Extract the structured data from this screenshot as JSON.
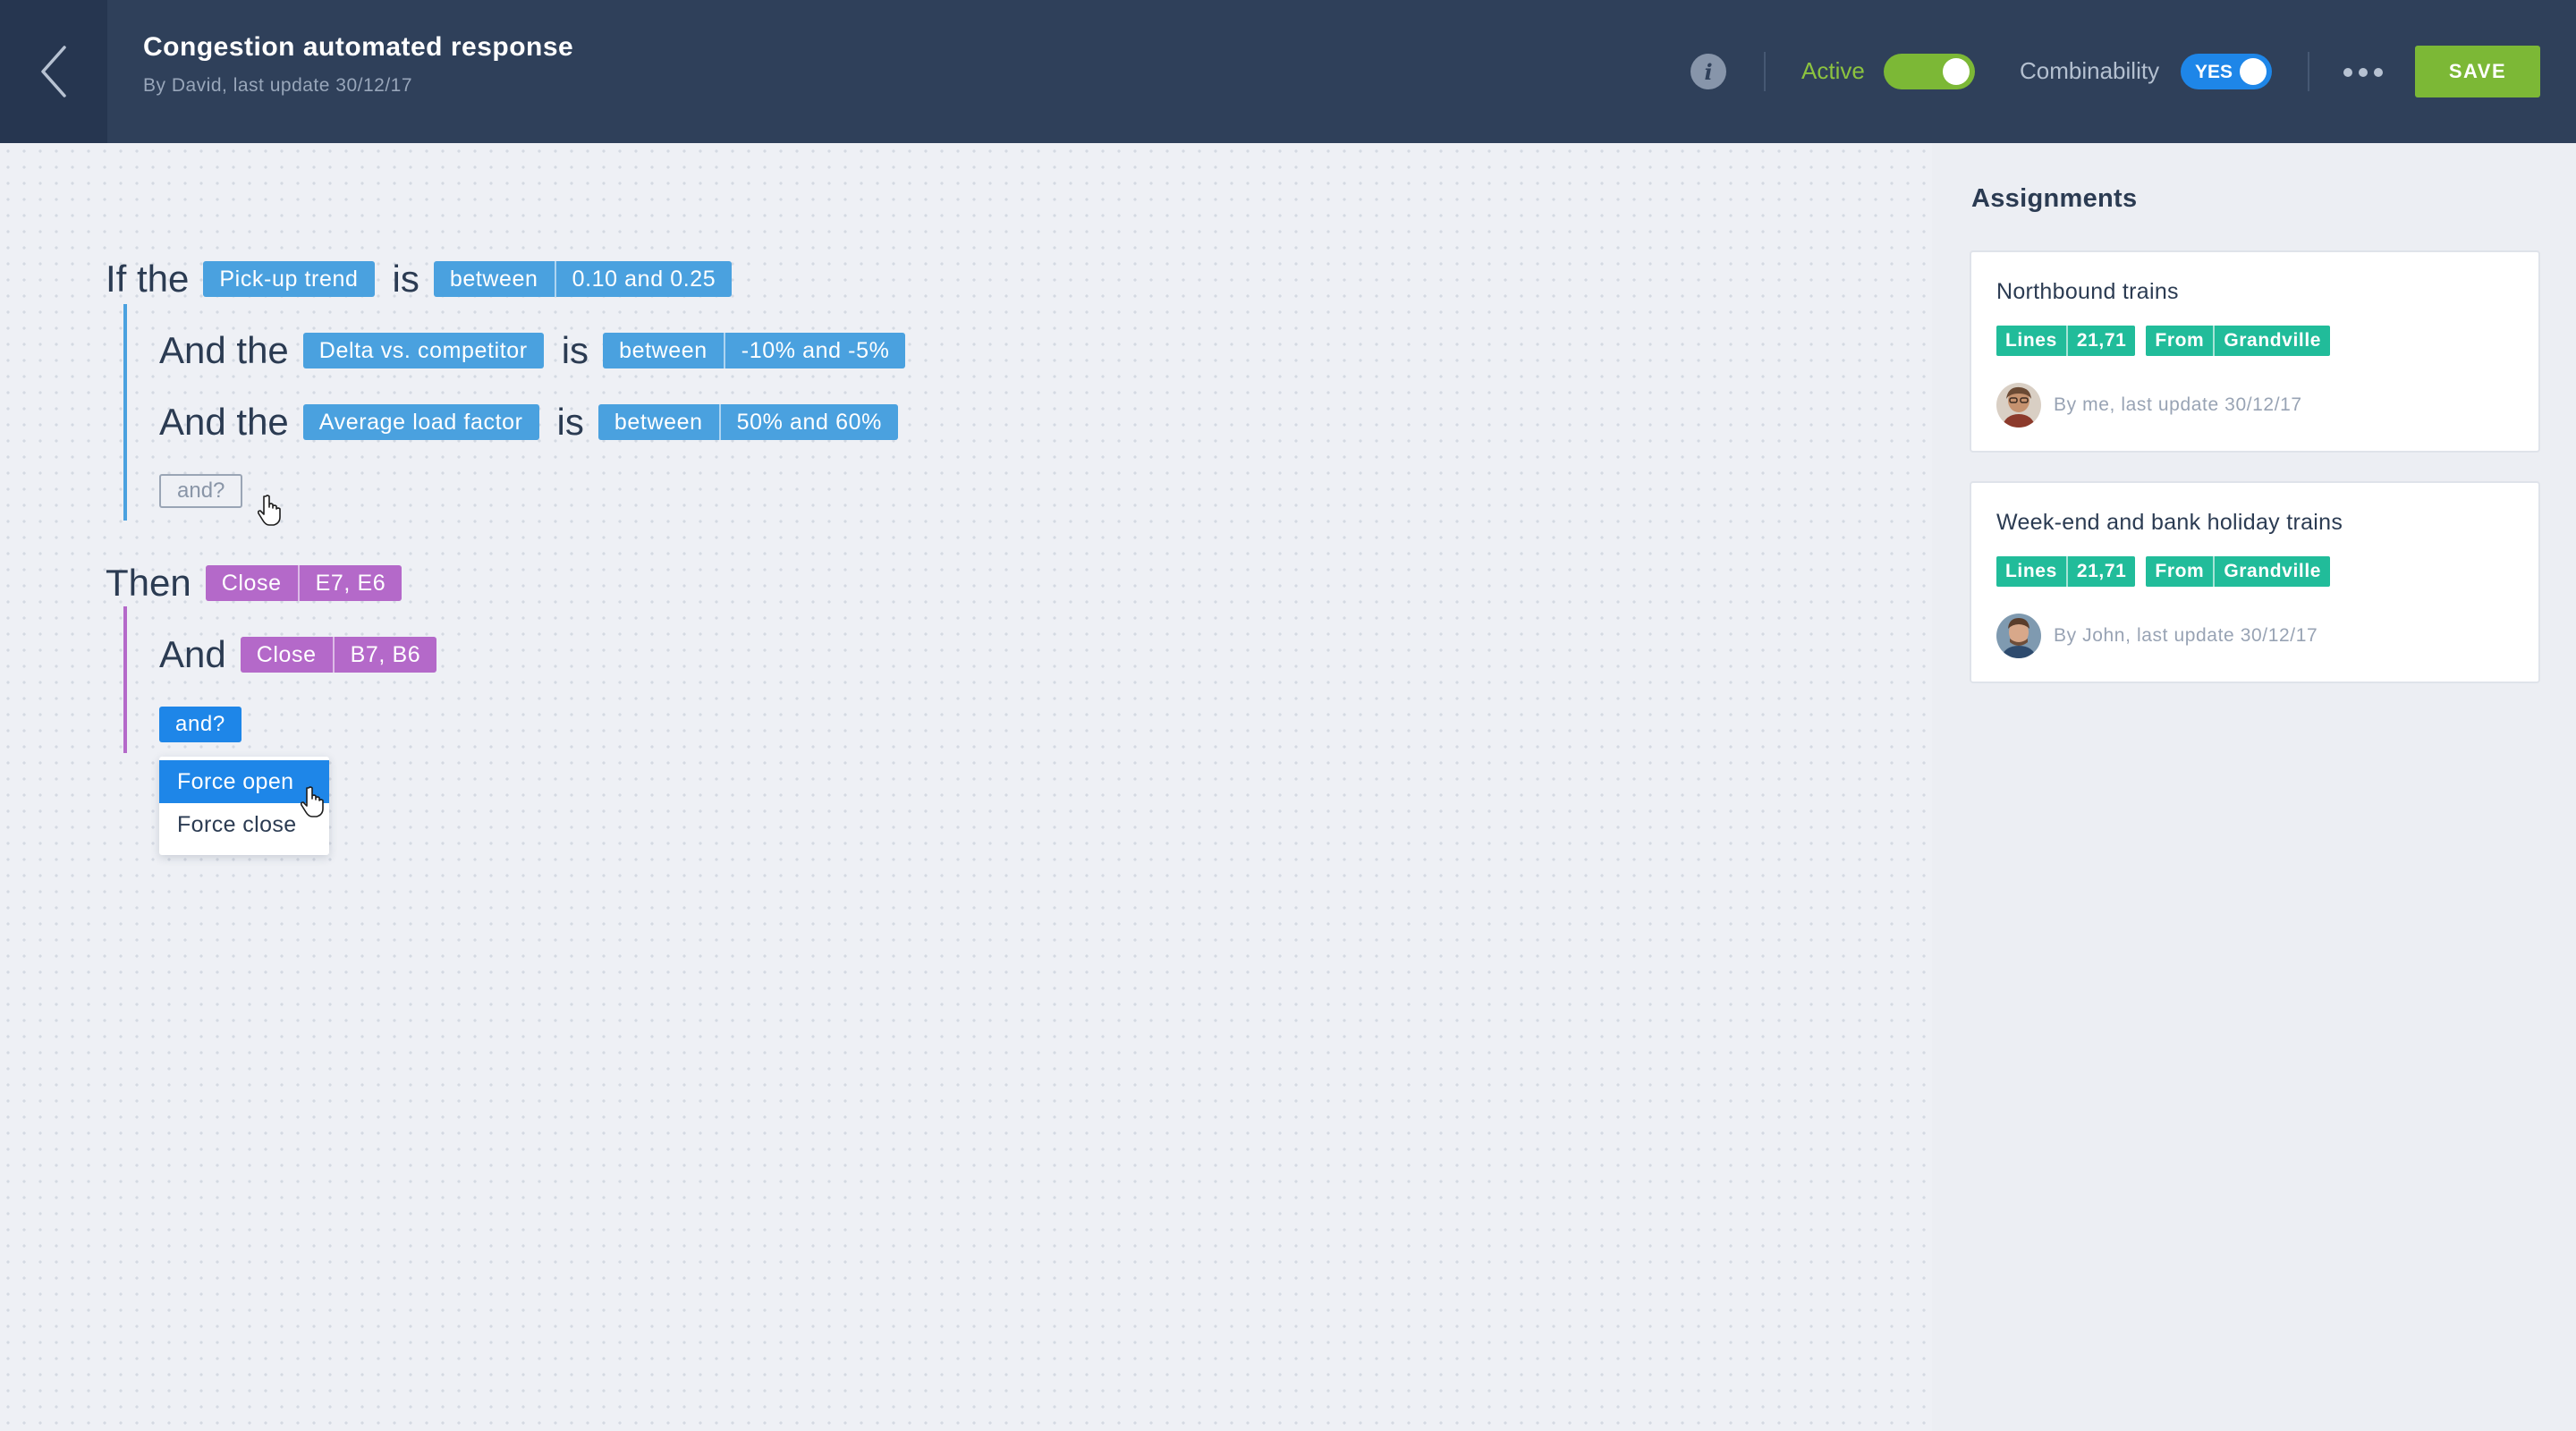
{
  "header": {
    "title": "Congestion automated response",
    "subtitle": "By David, last update 30/12/17",
    "active_label": "Active",
    "active_on": true,
    "combinability_label": "Combinability",
    "combinability_value": "YES",
    "save_label": "SAVE",
    "colors": {
      "background": "#2f405a",
      "accent_green": "#7cb836",
      "accent_blue": "#1e86e8"
    }
  },
  "rule": {
    "conditions": [
      {
        "prefix": "If the",
        "field": "Pick-up trend",
        "verb": "is",
        "operator": "between",
        "value": "0.10 and 0.25"
      },
      {
        "prefix": "And the",
        "field": "Delta vs. competitor",
        "verb": "is",
        "operator": "between",
        "value": "-10% and -5%"
      },
      {
        "prefix": "And the",
        "field": "Average load factor",
        "verb": "is",
        "operator": "between",
        "value": "50% and 60%"
      }
    ],
    "add_condition_label": "and?",
    "actions": [
      {
        "prefix": "Then",
        "action": "Close",
        "target": "E7, E6"
      },
      {
        "prefix": "And",
        "action": "Close",
        "target": "B7, B6"
      }
    ],
    "add_action_label": "and?",
    "action_menu": {
      "options": [
        "Force open",
        "Force close"
      ],
      "highlighted": "Force open"
    },
    "colors": {
      "condition": "#4aa1df",
      "action": "#b469c9"
    }
  },
  "assignments": {
    "title": "Assignments",
    "cards": [
      {
        "title": "Northbound trains",
        "tags": [
          {
            "key": "Lines",
            "value": "21,71"
          },
          {
            "key": "From",
            "value": "Grandville"
          }
        ],
        "meta": "By me, last update 30/12/17",
        "avatar": "avatar-me"
      },
      {
        "title": "Week-end and bank holiday trains",
        "tags": [
          {
            "key": "Lines",
            "value": "21,71"
          },
          {
            "key": "From",
            "value": "Grandville"
          }
        ],
        "meta": "By John, last update 30/12/17",
        "avatar": "avatar-john"
      }
    ],
    "tag_color": "#21bc9a"
  }
}
